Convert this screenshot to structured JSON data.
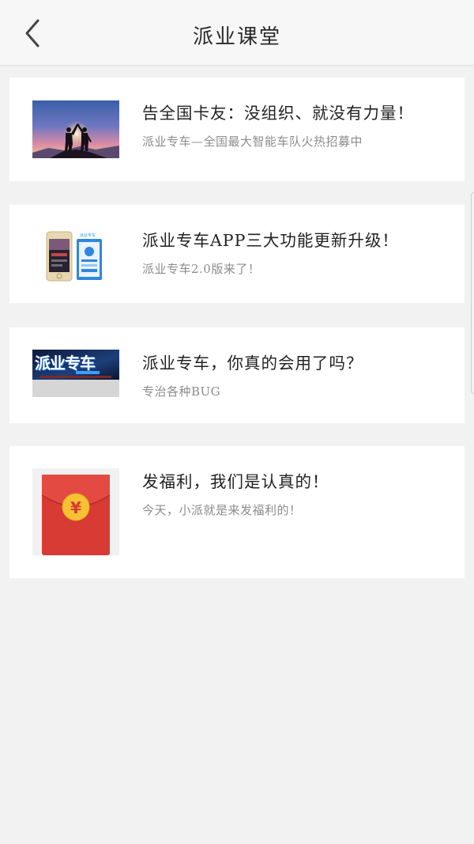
{
  "header": {
    "title": "派业课堂",
    "back_icon": "chevron-left-icon"
  },
  "articles": [
    {
      "title": "告全国卡友：没组织、就没有力量！",
      "subtitle": "派业专车—全国最大智能车队火热招募中",
      "thumbnail": "sunset-teamwork-image"
    },
    {
      "title": "派业专车APP三大功能更新升级！",
      "subtitle": "派业专车2.0版来了！",
      "thumbnail": "app-screens-image"
    },
    {
      "title": "派业专车，你真的会用了吗？",
      "subtitle": "专治各种BUG",
      "thumbnail": "paiye-banner-image",
      "thumbnail_text": "派业专车"
    },
    {
      "title": "发福利，我们是认真的！",
      "subtitle": "今天，小派就是来发福利的！",
      "thumbnail": "red-envelope-image",
      "thumbnail_symbol": "¥"
    }
  ],
  "colors": {
    "background": "#f2f2f2",
    "card": "#ffffff",
    "title_text": "#222222",
    "subtitle_text": "#8c8c8c",
    "envelope_red": "#d83a34",
    "coin_gold": "#f6c233"
  }
}
